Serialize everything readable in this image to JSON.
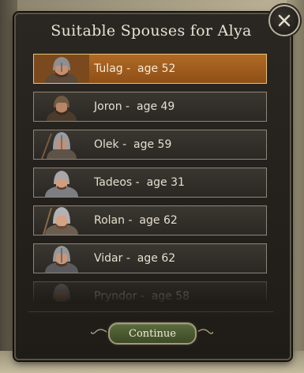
{
  "dialog": {
    "title": "Suitable Spouses for Alya",
    "continue_label": "Continue"
  },
  "candidates": [
    {
      "label": "Tulag -  age 52",
      "selected": true
    },
    {
      "label": "Joron -  age 49",
      "selected": false
    },
    {
      "label": "Olek -  age 59",
      "selected": false
    },
    {
      "label": "Tadeos -  age 31",
      "selected": false
    },
    {
      "label": "Rolan -  age 62",
      "selected": false
    },
    {
      "label": "Vidar -  age 62",
      "selected": false
    },
    {
      "label": "Pryndor -  age 58",
      "selected": false
    }
  ],
  "icons": {
    "close": "close-icon",
    "portrait": "warrior-portrait-icon"
  },
  "colors": {
    "selected_row": "#b06a25",
    "panel": "#1f1c18",
    "continue_button": "#4a5a30"
  }
}
